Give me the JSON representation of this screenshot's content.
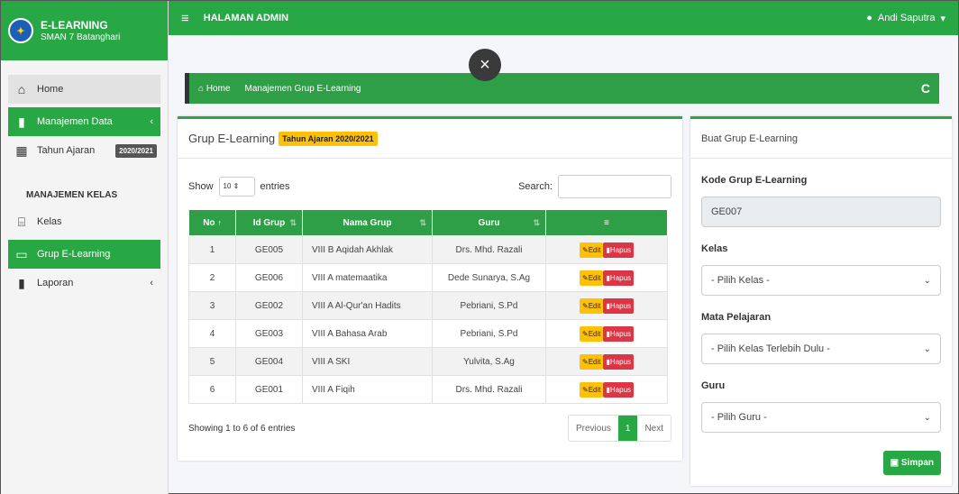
{
  "brand": {
    "title": "E-LEARNING",
    "subtitle": "SMAN 7 Batanghari"
  },
  "topbar": {
    "title": "HALAMAN ADMIN",
    "user": "Andi Saputra"
  },
  "sidebar": {
    "home": "Home",
    "manajemen_data": "Manajemen Data",
    "tahun_ajaran": "Tahun Ajaran",
    "tahun_badge": "2020/2021",
    "section": "MANAJEMEN KELAS",
    "kelas": "Kelas",
    "grup": "Grup E-Learning",
    "laporan": "Laporan"
  },
  "close": "×",
  "breadcrumb": {
    "home": "Home",
    "current": "Manajemen Grup E-Learning",
    "refresh": "C"
  },
  "main": {
    "title": "Grup E-Learning",
    "tahun_badge": "Tahun Ajaran 2020/2021",
    "show": "Show",
    "entries_value": "10",
    "entries": "entries",
    "search": "Search:",
    "columns": [
      "No",
      "Id Grup",
      "Nama Grup",
      "Guru",
      "≡"
    ],
    "rows": [
      {
        "no": "1",
        "id": "GE005",
        "nama": "VIII B Aqidah Akhlak",
        "guru": "Drs. Mhd. Razali"
      },
      {
        "no": "2",
        "id": "GE006",
        "nama": "VIII A matemaatika",
        "guru": "Dede Sunarya, S.Ag"
      },
      {
        "no": "3",
        "id": "GE002",
        "nama": "VIII A Al-Qur'an Hadits",
        "guru": "Pebriani, S.Pd"
      },
      {
        "no": "4",
        "id": "GE003",
        "nama": "VIII A Bahasa Arab",
        "guru": "Pebriani, S.Pd"
      },
      {
        "no": "5",
        "id": "GE004",
        "nama": "VIII A SKI",
        "guru": "Yulvita, S.Ag"
      },
      {
        "no": "6",
        "id": "GE001",
        "nama": "VIII A Fiqih",
        "guru": "Drs. Mhd. Razali"
      }
    ],
    "edit": "Edit",
    "hapus": "Hapus",
    "showing": "Showing 1 to 6 of 6 entries",
    "previous": "Previous",
    "page": "1",
    "next": "Next"
  },
  "side": {
    "title": "Buat Grup E-Learning",
    "kode_label": "Kode Grup E-Learning",
    "kode_value": "GE007",
    "kelas_label": "Kelas",
    "kelas_value": "- Pilih Kelas -",
    "mapel_label": "Mata Pelajaran",
    "mapel_value": "- Pilih Kelas Terlebih Dulu -",
    "guru_label": "Guru",
    "guru_value": "- Pilih Guru -",
    "simpan": "Simpan"
  }
}
